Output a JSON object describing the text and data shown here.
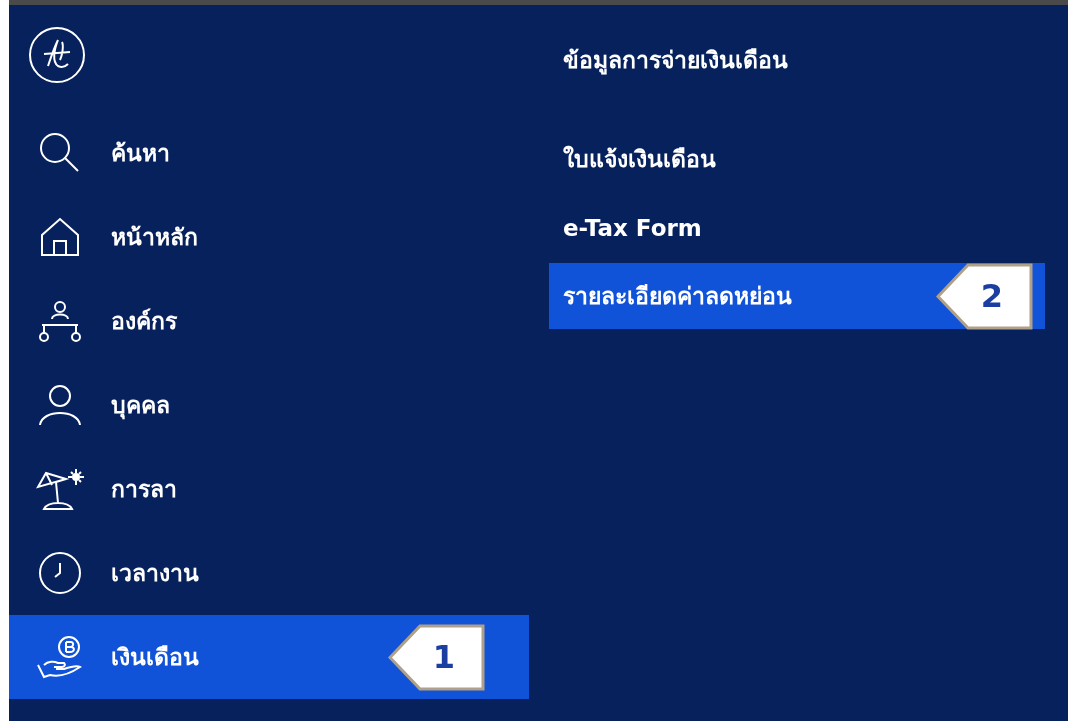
{
  "sidebar": {
    "items": [
      {
        "label": "ค้นหา",
        "selected": false
      },
      {
        "label": "หน้าหลัก",
        "selected": false
      },
      {
        "label": "องค์กร",
        "selected": false
      },
      {
        "label": "บุคคล",
        "selected": false
      },
      {
        "label": "การลา",
        "selected": false
      },
      {
        "label": "เวลางาน",
        "selected": false
      },
      {
        "label": "เงินเดือน",
        "selected": true,
        "callout": "1"
      }
    ]
  },
  "submenu": {
    "heading": "ข้อมูลการจ่ายเงินเดือน",
    "items": [
      {
        "label": "ใบแจ้งเงินเดือน",
        "selected": false
      },
      {
        "label": "e-Tax Form",
        "selected": false
      },
      {
        "label": "รายละเอียดค่าลดหย่อน",
        "selected": true,
        "callout": "2"
      }
    ]
  }
}
